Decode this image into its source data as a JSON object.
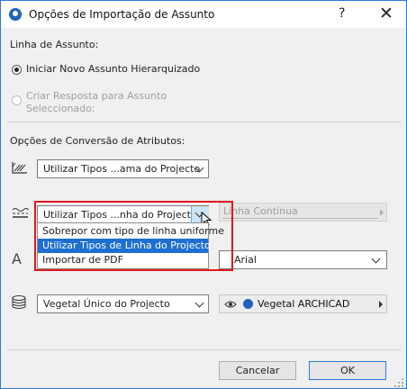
{
  "window": {
    "title": "Opções de Importação de Assunto",
    "help": "?",
    "close": "✕"
  },
  "subject_line": {
    "heading": "Linha de Assunto:",
    "option_new": "Iniciar Novo Assunto Hierarquizado",
    "option_reply_line1": "Criar Resposta para Assunto",
    "option_reply_line2": "Seleccionado:"
  },
  "conversion": {
    "heading": "Opções de Conversão de Atributos:",
    "fill_dropdown": "Utilizar Tipos ...ama do Projecto",
    "line_dropdown": "Utilizar Tipos ...nha do Projecto",
    "line_type_field": "Linha Contínua",
    "font_dropdown": "Arial",
    "surface_dropdown": "Vegetal Único do Projecto",
    "surface_value": "Vegetal ARCHICAD"
  },
  "popup": {
    "items": [
      {
        "label": "Sobrepor com tipo de linha uniforme"
      },
      {
        "label": "Utilizar Tipos de Linha do Projecto"
      },
      {
        "label": "Importar de PDF"
      }
    ]
  },
  "buttons": {
    "cancel": "Cancelar",
    "ok": "OK"
  }
}
